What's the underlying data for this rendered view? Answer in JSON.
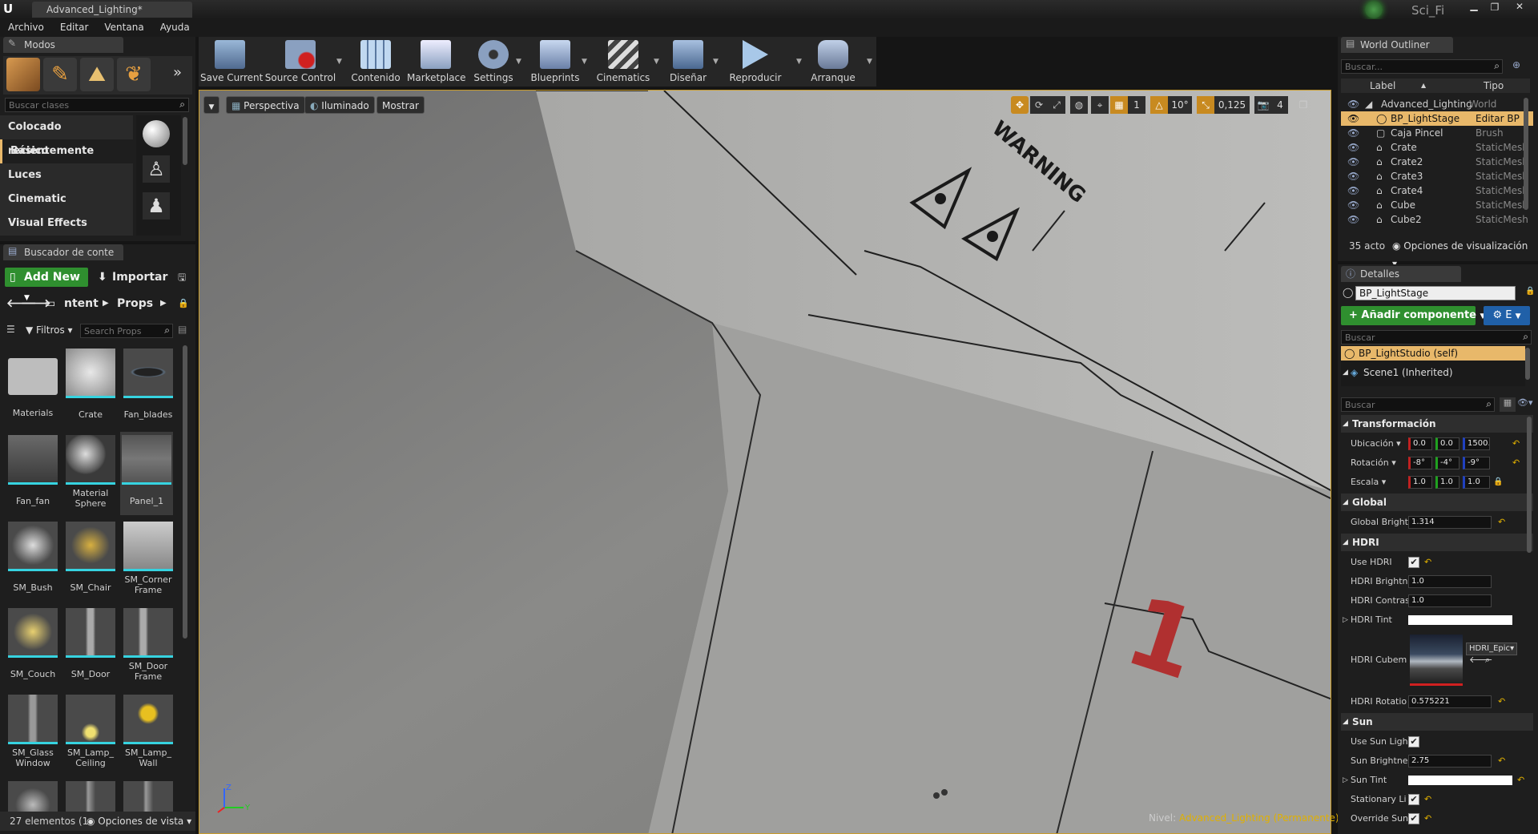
{
  "window": {
    "tab_title": "Advanced_Lighting*",
    "project": "Sci_Fi"
  },
  "menu": [
    "Archivo",
    "Editar",
    "Ventana",
    "Ayuda"
  ],
  "modes": {
    "tab": "Modos",
    "search_placeholder": "Buscar clases",
    "categories": [
      "Colocado recientemente",
      "Básico",
      "Luces",
      "Cinematic",
      "Visual Effects"
    ],
    "selected_category": "Básico"
  },
  "toolbar": [
    {
      "label": "Save Current"
    },
    {
      "label": "Source Control"
    },
    {
      "label": "Contenido"
    },
    {
      "label": "Marketplace"
    },
    {
      "label": "Settings"
    },
    {
      "label": "Blueprints"
    },
    {
      "label": "Cinematics"
    },
    {
      "label": "Diseñar"
    },
    {
      "label": "Reproducir"
    },
    {
      "label": "Arranque"
    }
  ],
  "content_browser": {
    "tab": "Buscador de conte",
    "add_new": "Add New",
    "import": "Importar",
    "path": [
      "ntent",
      "Props"
    ],
    "filters": "Filtros",
    "search_placeholder": "Search Props",
    "assets": [
      "Materials",
      "Crate",
      "Fan_blades",
      "Fan_fan",
      "Material Sphere",
      "Panel_1",
      "SM_Bush",
      "SM_Chair",
      "SM_Corner Frame",
      "SM_Couch",
      "SM_Door",
      "SM_Door Frame",
      "SM_Glass Window",
      "SM_Lamp_ Ceiling",
      "SM_Lamp_ Wall"
    ],
    "footer_count": "27 elementos (1",
    "view_options": "Opciones de vista"
  },
  "viewport": {
    "perspective": "Perspectiva",
    "lit": "Iluminado",
    "show": "Mostrar",
    "grid_value": "1",
    "angle_value": "10°",
    "scale_value": "0,125",
    "camera_speed": "4",
    "level_label": "Nivel:",
    "level_name": "Advanced_Lighting (Permanente)",
    "decal_text": "WARNING",
    "decal_number": "1"
  },
  "outliner": {
    "tab": "World Outliner",
    "search_placeholder": "Buscar...",
    "col_label": "Label",
    "col_type": "Tipo",
    "rows": [
      {
        "label": "Advanced_Lighting",
        "type": "World"
      },
      {
        "label": "BP_LightStage",
        "type": "Editar BP"
      },
      {
        "label": "Caja Pincel",
        "type": "Brush"
      },
      {
        "label": "Crate",
        "type": "StaticMesh"
      },
      {
        "label": "Crate2",
        "type": "StaticMesh"
      },
      {
        "label": "Crate3",
        "type": "StaticMesh"
      },
      {
        "label": "Crate4",
        "type": "StaticMesh"
      },
      {
        "label": "Cube",
        "type": "StaticMesh"
      },
      {
        "label": "Cube2",
        "type": "StaticMesh"
      }
    ],
    "count": "35 acto",
    "view_options": "Opciones de visualización"
  },
  "details": {
    "tab": "Detalles",
    "name": "BP_LightStage",
    "add_component": "Añadir componente",
    "edit_bp": "E",
    "search_placeholder": "Buscar",
    "components": [
      "BP_LightStudio (self)",
      "Scene1 (Inherited)"
    ],
    "search2_placeholder": "Buscar",
    "sections": {
      "transform": "Transformación",
      "global": "Global",
      "hdri": "HDRI",
      "sun": "Sun"
    },
    "location": {
      "label": "Ubicación",
      "x": "0.0",
      "y": "0.0",
      "z": "1500."
    },
    "rotation": {
      "label": "Rotación",
      "x": "-8°",
      "y": "-4°",
      "z": "-9°"
    },
    "scale": {
      "label": "Escala",
      "x": "1.0",
      "y": "1.0",
      "z": "1.0"
    },
    "global_bright": {
      "label": "Global Bright",
      "value": "1.314"
    },
    "use_hdri": {
      "label": "Use HDRI"
    },
    "hdri_brightness": {
      "label": "HDRI Brightn",
      "value": "1.0"
    },
    "hdri_contrast": {
      "label": "HDRI Contras",
      "value": "1.0"
    },
    "hdri_tint": {
      "label": "HDRI Tint"
    },
    "hdri_cubemap": {
      "label": "HDRI Cubem",
      "asset": "HDRI_Epic"
    },
    "hdri_rotation": {
      "label": "HDRI Rotatio",
      "value": "0.575221"
    },
    "use_sun": {
      "label": "Use Sun Ligh"
    },
    "sun_brightness": {
      "label": "Sun Brightne",
      "value": "2.75"
    },
    "sun_tint": {
      "label": "Sun Tint"
    },
    "stationary": {
      "label": "Stationary Li"
    },
    "override_sun": {
      "label": "Override Sun"
    }
  },
  "colors": {
    "accent": "#36d3e0",
    "selected_row": "#e8b86a",
    "add_component": "#2f8f2f",
    "level": "#e0b000"
  }
}
